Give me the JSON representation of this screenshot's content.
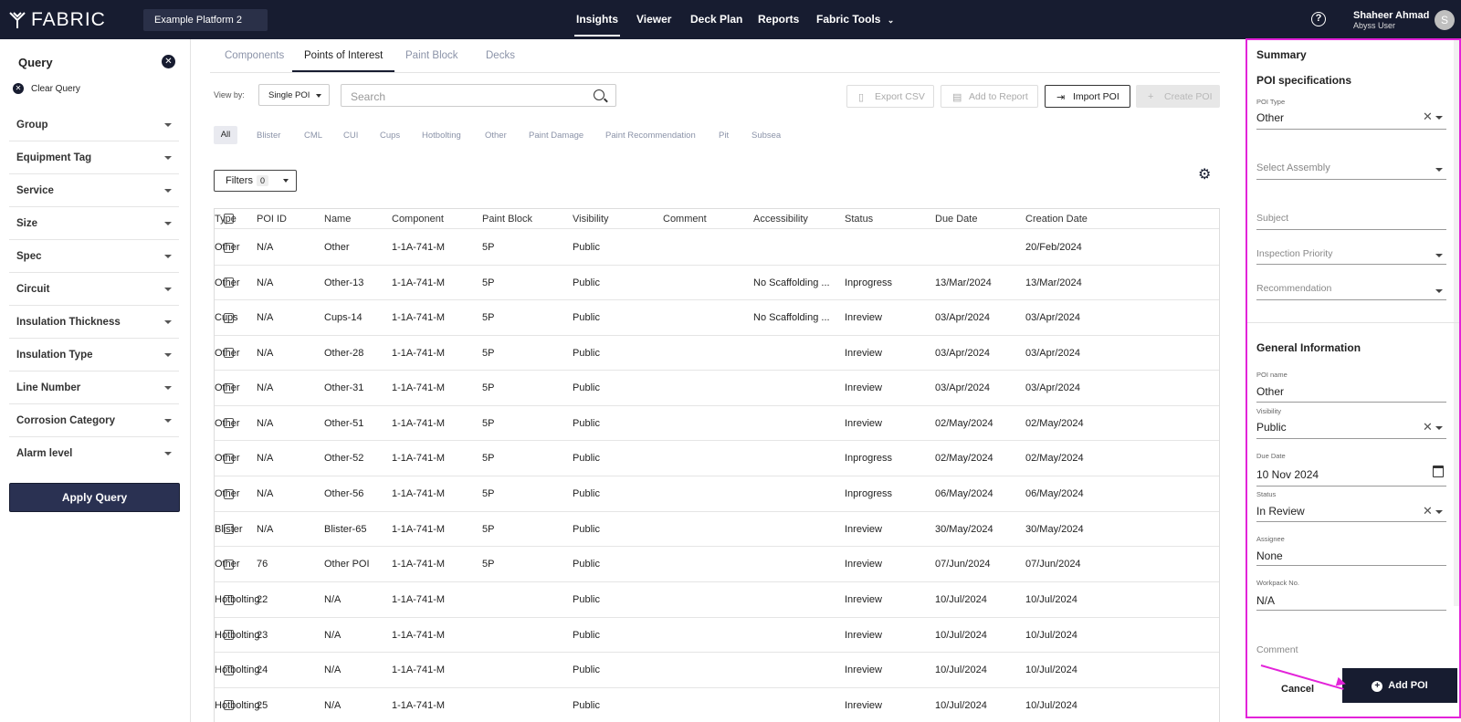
{
  "app": {
    "brand": "FABRIC",
    "platform": "Example Platform 2"
  },
  "nav": {
    "items": [
      "Insights",
      "Viewer",
      "Deck Plan",
      "Reports",
      "Fabric Tools"
    ]
  },
  "user": {
    "name": "Shaheer Ahmad",
    "role": "Abyss User",
    "initial": "S",
    "help": "?"
  },
  "query": {
    "title": "Query",
    "clear_label": "Clear Query",
    "items": [
      "Group",
      "Equipment Tag",
      "Service",
      "Size",
      "Spec",
      "Circuit",
      "Insulation Thickness",
      "Insulation Type",
      "Line Number",
      "Corrosion Category",
      "Alarm level"
    ],
    "apply_label": "Apply Query"
  },
  "tabs": [
    "Components",
    "Points of Interest",
    "Paint Block",
    "Decks"
  ],
  "toolbar": {
    "view_by_label": "View by:",
    "view_by_value": "Single POI",
    "search_placeholder": "Search",
    "export_csv": "Export CSV",
    "add_to_report": "Add to Report",
    "import_poi": "Import POI",
    "create_poi": "Create POI"
  },
  "chips": [
    "All",
    "Blister",
    "CML",
    "CUI",
    "Cups",
    "Hotbolting",
    "Other",
    "Paint Damage",
    "Paint Recommendation",
    "Pit",
    "Subsea"
  ],
  "filters": {
    "label": "Filters",
    "count": "0"
  },
  "table": {
    "columns": [
      "POI ID",
      "Name",
      "Component",
      "Paint Block",
      "Visibility",
      "Comment",
      "Accessibility",
      "Status",
      "Due Date",
      "Creation Date",
      "Type"
    ],
    "rows": [
      [
        "N/A",
        "Other",
        "1-1A-741-M",
        "5P",
        "Public",
        "",
        "",
        "",
        "",
        "20/Feb/2024",
        "Other"
      ],
      [
        "N/A",
        "Other-13",
        "1-1A-741-M",
        "5P",
        "Public",
        "",
        "No Scaffolding ...",
        "Inprogress",
        "13/Mar/2024",
        "13/Mar/2024",
        "Other"
      ],
      [
        "N/A",
        "Cups-14",
        "1-1A-741-M",
        "5P",
        "Public",
        "",
        "No Scaffolding ...",
        "Inreview",
        "03/Apr/2024",
        "03/Apr/2024",
        "Cups"
      ],
      [
        "N/A",
        "Other-28",
        "1-1A-741-M",
        "5P",
        "Public",
        "",
        "",
        "Inreview",
        "03/Apr/2024",
        "03/Apr/2024",
        "Other"
      ],
      [
        "N/A",
        "Other-31",
        "1-1A-741-M",
        "5P",
        "Public",
        "",
        "",
        "Inreview",
        "03/Apr/2024",
        "03/Apr/2024",
        "Other"
      ],
      [
        "N/A",
        "Other-51",
        "1-1A-741-M",
        "5P",
        "Public",
        "",
        "",
        "Inreview",
        "02/May/2024",
        "02/May/2024",
        "Other"
      ],
      [
        "N/A",
        "Other-52",
        "1-1A-741-M",
        "5P",
        "Public",
        "",
        "",
        "Inprogress",
        "02/May/2024",
        "02/May/2024",
        "Other"
      ],
      [
        "N/A",
        "Other-56",
        "1-1A-741-M",
        "5P",
        "Public",
        "",
        "",
        "Inprogress",
        "06/May/2024",
        "06/May/2024",
        "Other"
      ],
      [
        "N/A",
        "Blister-65",
        "1-1A-741-M",
        "5P",
        "Public",
        "",
        "",
        "Inreview",
        "30/May/2024",
        "30/May/2024",
        "Blister"
      ],
      [
        "76",
        "Other POI",
        "1-1A-741-M",
        "5P",
        "Public",
        "",
        "",
        "Inreview",
        "07/Jun/2024",
        "07/Jun/2024",
        "Other"
      ],
      [
        "22",
        "N/A",
        "1-1A-741-M",
        "",
        "Public",
        "",
        "",
        "Inreview",
        "10/Jul/2024",
        "10/Jul/2024",
        "Hotbolting"
      ],
      [
        "23",
        "N/A",
        "1-1A-741-M",
        "",
        "Public",
        "",
        "",
        "Inreview",
        "10/Jul/2024",
        "10/Jul/2024",
        "Hotbolting"
      ],
      [
        "24",
        "N/A",
        "1-1A-741-M",
        "",
        "Public",
        "",
        "",
        "Inreview",
        "10/Jul/2024",
        "10/Jul/2024",
        "Hotbolting"
      ],
      [
        "25",
        "N/A",
        "1-1A-741-M",
        "",
        "Public",
        "",
        "",
        "Inreview",
        "10/Jul/2024",
        "10/Jul/2024",
        "Hotbolting"
      ]
    ]
  },
  "summary": {
    "title": "Summary",
    "poi_spec_title": "POI specifications",
    "poi_type_label": "POI Type",
    "poi_type_value": "Other",
    "assembly_placeholder": "Select Assembly",
    "subject_placeholder": "Subject",
    "priority_placeholder": "Inspection Priority",
    "recommendation_placeholder": "Recommendation",
    "general_title": "General Information",
    "poi_name_label": "POI name",
    "poi_name_value": "Other",
    "visibility_label": "Visibility",
    "visibility_value": "Public",
    "due_date_label": "Due Date",
    "due_date_value": "10 Nov 2024",
    "status_label": "Status",
    "status_value": "In Review",
    "assignee_label": "Assignee",
    "assignee_value": "None",
    "workpack_label": "Workpack No.",
    "workpack_value": "N/A",
    "comment_placeholder": "Comment",
    "cancel_label": "Cancel",
    "add_label": "Add POI"
  },
  "colors": {
    "nav_bg": "#171c30",
    "highlight": "#e323d9"
  }
}
